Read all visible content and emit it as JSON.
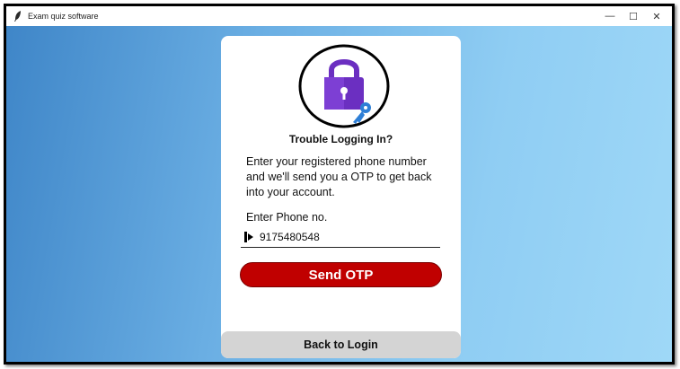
{
  "window": {
    "title": "Exam quiz software",
    "minimize_glyph": "—",
    "maximize_glyph": "☐",
    "close_glyph": "✕"
  },
  "card": {
    "title": "Trouble Logging In?",
    "description": "Enter your registered phone number and we'll send you a OTP to get back into your account.",
    "phone_label": "Enter Phone no.",
    "phone_value": "9175480548",
    "send_button": "Send OTP",
    "back_button": "Back to Login"
  },
  "colors": {
    "send_button": "#c00000",
    "lock_body": "#6b2fc1",
    "key": "#2e7fd6",
    "back_button_bg": "#d4d4d4"
  },
  "icons": {
    "app": "feather-icon",
    "lock": "lock-key-icon",
    "phone": "phone-icon"
  }
}
